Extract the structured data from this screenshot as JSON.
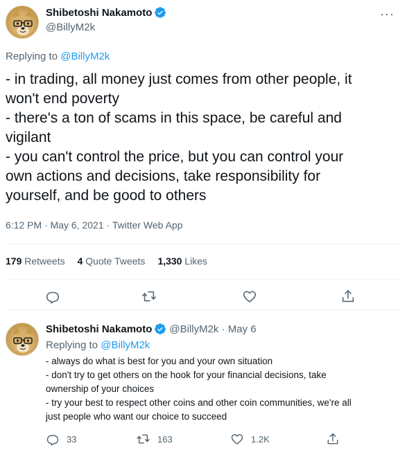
{
  "main_tweet": {
    "display_name": "Shibetoshi Nakamoto",
    "handle": "@BillyM2k",
    "replying_label": "Replying to",
    "replying_handle": "@BillyM2k",
    "text_lines": [
      "- in trading, all money just comes from other people, it",
      "won't end poverty",
      "- there's a ton of scams in this space, be careful and",
      "vigilant",
      "- you can't control the price, but you can control your",
      "own actions and decisions, take responsibility for",
      "yourself, and be good to others"
    ],
    "timestamp": "6:12 PM · May 6, 2021 · Twitter Web App",
    "stats": {
      "retweets_count": "179",
      "retweets_label": "Retweets",
      "quotes_count": "4",
      "quotes_label": "Quote Tweets",
      "likes_count": "1,330",
      "likes_label": "Likes"
    },
    "icons": [
      "reply-icon",
      "retweet-icon",
      "like-icon",
      "share-icon",
      "more-icon",
      "verified-icon"
    ]
  },
  "reply_tweet": {
    "display_name": "Shibetoshi Nakamoto",
    "handle_and_date": "@BillyM2k · May 6",
    "replying_label": "Replying to",
    "replying_handle": "@BillyM2k",
    "text_lines": [
      "- always do what is best for you and your own situation",
      "- don't try to get others on the hook for your financial decisions, take",
      "ownership of your choices",
      "- try your best to respect other coins and other coin communities, we're all",
      "just people who want our choice to succeed"
    ],
    "replies": "33",
    "retweets": "163",
    "likes": "1.2K"
  },
  "colors": {
    "accent": "#1d9bf0",
    "text": "#0f1419",
    "muted": "#536471",
    "divider": "#eff3f4"
  }
}
